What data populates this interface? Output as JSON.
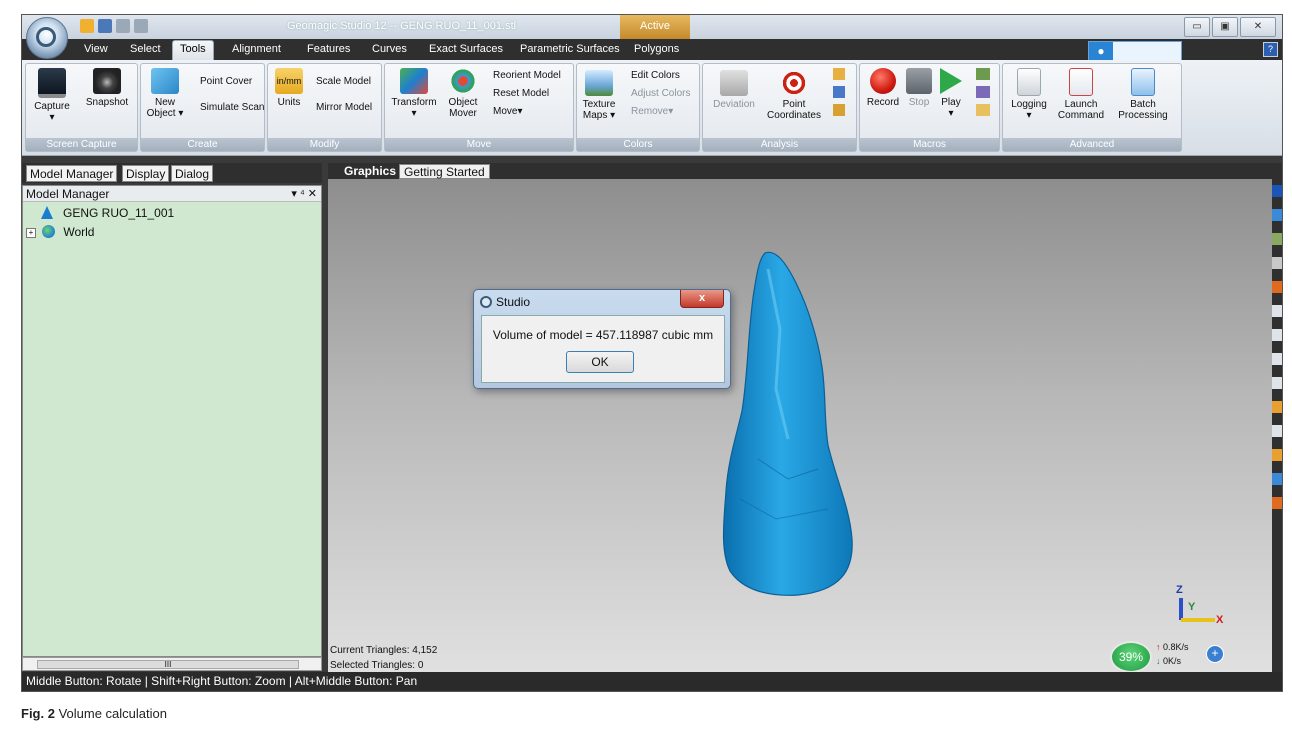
{
  "titlebar": {
    "title": "Geomagic Studio 12 -- GENG RUO_11_001.stl",
    "context_tab": "Active"
  },
  "menu_tabs": [
    "View",
    "Select",
    "Tools",
    "Alignment",
    "Features",
    "Curves",
    "Exact Surfaces",
    "Parametric Surfaces",
    "Polygons"
  ],
  "selected_tab": "Tools",
  "ribbon": {
    "screen_capture": {
      "label": "Screen Capture",
      "capture": "Capture",
      "snapshot": "Snapshot"
    },
    "create": {
      "label": "Create",
      "new_object_1": "New",
      "new_object_2": "Object ▾",
      "point_cover": "Point Cover",
      "simulate_scan": "Simulate Scan"
    },
    "modify": {
      "label": "Modify",
      "units": "Units",
      "scale_model": "Scale Model",
      "mirror_model": "Mirror Model"
    },
    "move": {
      "label": "Move",
      "transform": "Transform",
      "object_mover_1": "Object",
      "object_mover_2": "Mover",
      "reorient_model": "Reorient Model",
      "reset_model": "Reset Model",
      "move": "Move▾"
    },
    "colors": {
      "label": "Colors",
      "texture_maps_1": "Texture",
      "texture_maps_2": "Maps ▾",
      "edit_colors": "Edit Colors",
      "adjust_colors": "Adjust Colors",
      "remove": "Remove▾"
    },
    "analysis": {
      "label": "Analysis",
      "deviation": "Deviation",
      "point_coordinates_1": "Point",
      "point_coordinates_2": "Coordinates"
    },
    "macros": {
      "label": "Macros",
      "record": "Record",
      "stop": "Stop",
      "play": "Play"
    },
    "advanced": {
      "label": "Advanced",
      "logging": "Logging",
      "launch_command_1": "Launch",
      "launch_command_2": "Command",
      "batch_processing_1": "Batch",
      "batch_processing_2": "Processing"
    }
  },
  "left_panel": {
    "tabs": [
      "Model Manager",
      "Display",
      "Dialog"
    ],
    "header": "Model Manager",
    "header_controls": "▾ ⁴ ✕",
    "items": [
      "GENG RUO_11_001",
      "World"
    ],
    "scroll_label": "III"
  },
  "graphics_tabs": [
    "Graphics",
    "Getting Started"
  ],
  "viewport": {
    "current_triangles": "Current Triangles: 4,152",
    "selected_triangles": "Selected Triangles: 0",
    "axis_z": "Z",
    "axis_y": "Y",
    "axis_x": "X"
  },
  "dialog": {
    "title": "Studio",
    "message": "Volume of model = 457.118987 cubic mm",
    "ok": "OK",
    "close": "x"
  },
  "net_widget": {
    "percent": "39%",
    "upload": "0.8K/s",
    "download": "0K/s"
  },
  "statusbar": "Middle Button: Rotate | Shift+Right Button: Zoom | Alt+Middle Button: Pan",
  "caption": {
    "fig": "Fig. 2",
    "text": "Volume calculation"
  },
  "colors": {
    "model": "#1596d4",
    "panel_bg": "#cfe8cf",
    "accent": "#c48a2a"
  }
}
